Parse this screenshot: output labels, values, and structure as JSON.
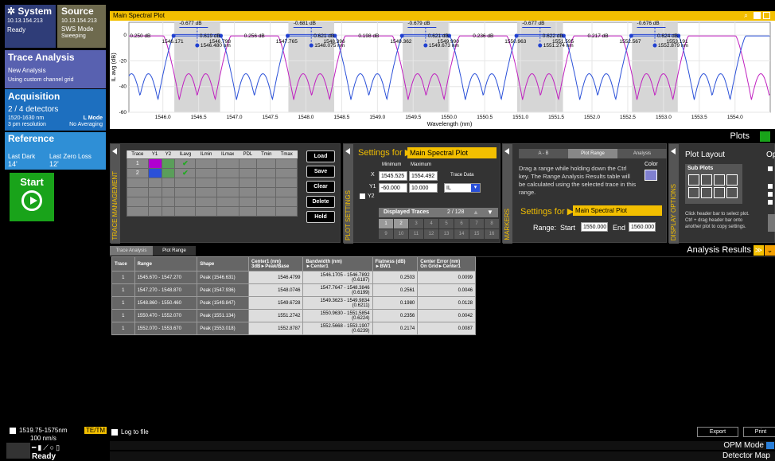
{
  "sidebar": {
    "system": {
      "title": "System",
      "ip": "10.13.154.213",
      "status": "Ready"
    },
    "source": {
      "title": "Source",
      "ip": "10.13.154.213",
      "mode": "SWS Mode",
      "state": "Sweeping"
    },
    "trace_analysis": {
      "title": "Trace Analysis",
      "new": "New Analysis",
      "grid": "Using custom channel grid"
    },
    "acquisition": {
      "title": "Acquisition",
      "detectors": "2 / 4 detectors",
      "range": "1520-1630 nm",
      "resolution": "3 pm resolution",
      "l_mode": "L Mode",
      "averaging": "No Averaging"
    },
    "reference": {
      "title": "Reference",
      "last_dark_label": "Last Dark",
      "last_dark_value": "14'",
      "last_zero_label": "Last Zero Loss",
      "last_zero_value": "12'"
    },
    "start": "Start",
    "range": "1519.75-1575nm",
    "speed": "100 nm/s",
    "tetm": "TE/TM",
    "status": "Ready"
  },
  "plot": {
    "title": "Main Spectral Plot",
    "ylabel": "IL avg (dB)",
    "xlabel": "Wavelength (nm)",
    "x_ticks": [
      "1546.0",
      "1546.5",
      "1547.0",
      "1547.5",
      "1548.0",
      "1548.5",
      "1549.0",
      "1549.5",
      "1550.0",
      "1550.5",
      "1551.0",
      "1551.5",
      "1552.0",
      "1552.5",
      "1553.0",
      "1553.5",
      "1554.0"
    ],
    "y_ticks": [
      "0",
      "-20",
      "-40",
      "-60"
    ],
    "markers": {
      "db_top": [
        "-0.677 dB",
        "-0.681 dB",
        "-0.679 dB",
        "-0.677 dB",
        "-0.676 dB"
      ],
      "db_left": [
        "0.250 dB",
        "0.256 dB",
        "0.198 dB",
        "0.236 dB",
        "0.217 dB"
      ],
      "db_mid": [
        "0.619 dB",
        "0.621 dB",
        "0.621 dB",
        "0.622 dB",
        "0.624 dB"
      ],
      "wl_low": [
        "1546.171",
        "1547.765",
        "1549.362",
        "1550.963",
        "1552.567"
      ],
      "wl_high": [
        "1546.798",
        "1548.396",
        "1549.990",
        "1551.595",
        "1553.191"
      ],
      "wl_center": [
        "1546.480 nm",
        "1548.075 nm",
        "1549.673 nm",
        "1551.274 nm",
        "1552.879 nm"
      ]
    }
  },
  "plots_label": "Plots",
  "trace_mgmt": {
    "label": "TRACE MANAGEMENT",
    "headers": [
      "Trace",
      "Y1",
      "Y2",
      "ILavg",
      "ILmin",
      "ILmax",
      "PDL",
      "Tmin",
      "Tmax"
    ],
    "rows": [
      {
        "trace": "1",
        "check": "✔",
        "y1": "#b000d0"
      },
      {
        "trace": "2",
        "check": "✔",
        "y1": "#2a50d8"
      }
    ],
    "buttons": [
      "Load",
      "Save",
      "Clear",
      "Delete",
      "Hold"
    ]
  },
  "plot_settings": {
    "label": "PLOT SETTINGS",
    "settings_for": "Settings for ▶",
    "target": "Main Spectral Plot",
    "min": "Minimum",
    "max": "Maximum",
    "x_label": "X",
    "x_min": "1545.525",
    "x_max": "1554.492",
    "y1_label": "Y1",
    "y1_min": "-60.000",
    "y1_max": "10.000",
    "trace_data": "Trace Data",
    "trace_data_value": "IL",
    "y2_label": "Y2",
    "displayed": "Displayed Traces",
    "displayed_count": "2 / 128",
    "pages": [
      "1",
      "2",
      "3",
      "4",
      "5",
      "6",
      "7",
      "8",
      "9",
      "10",
      "11",
      "12",
      "13",
      "14",
      "15",
      "16"
    ]
  },
  "markers": {
    "label": "MARKERS",
    "tabs": [
      "A - B",
      "Plot Range",
      "Analysis"
    ],
    "desc": "Drag a range while holding down the Ctrl key. The Range Analysis Results table will be calculated using the selected trace in this range.",
    "color": "Color",
    "settings_for": "Settings for ▶",
    "target": "Main Spectral Plot",
    "range": "Range:",
    "start": "Start",
    "start_val": "1550.000",
    "end": "End",
    "end_val": "1560.000"
  },
  "display_options": {
    "label": "DISPLAY OPTIONS",
    "layout": "Plot Layout",
    "op": "Op",
    "subplots": "Sub Plots",
    "hint": "Click header bar to select plot. Ctrl + drag header bar onto another plot to copy settings."
  },
  "results": {
    "tabs": [
      "Trace Analysis",
      "Plot Range"
    ],
    "title": "Analysis Results",
    "headers": [
      "Trace",
      "Range",
      "Shape",
      "Center1 (nm)\n3dB►Peak/Base",
      "Bandwidth (nm)\n►Center1",
      "Flatness (dB)\n►BW1",
      "Center Error (nm)\nOn Grid►Center1"
    ],
    "rows": [
      [
        "1",
        "1545.670 - 1547.270",
        "Peak (1546.631)",
        "1546.4799",
        "1546.1705 - 1546.7892\n(0.6187)",
        "0.2503",
        "0.0099"
      ],
      [
        "1",
        "1547.270 - 1548.870",
        "Peak (1547.936)",
        "1548.0746",
        "1547.7647 - 1548.3846\n(0.6199)",
        "0.2561",
        "0.0046"
      ],
      [
        "1",
        "1548.860 - 1550.460",
        "Peak (1549.847)",
        "1549.6728",
        "1549.3623 - 1549.9834\n(0.6211)",
        "0.1980",
        "0.0128"
      ],
      [
        "1",
        "1550.470 - 1552.070",
        "Peak (1551.134)",
        "1551.2742",
        "1550.9630 - 1551.5854\n(0.6224)",
        "0.2356",
        "0.0042"
      ],
      [
        "1",
        "1552.070 - 1553.670",
        "Peak (1553.018)",
        "1552.8787",
        "1552.5668 - 1553.1907\n(0.6239)",
        "0.2174",
        "0.0087"
      ]
    ]
  },
  "footer": {
    "log": "Log to file",
    "export": "Export",
    "print": "Print",
    "opm": "OPM Mode",
    "detector": "Detector Map"
  }
}
